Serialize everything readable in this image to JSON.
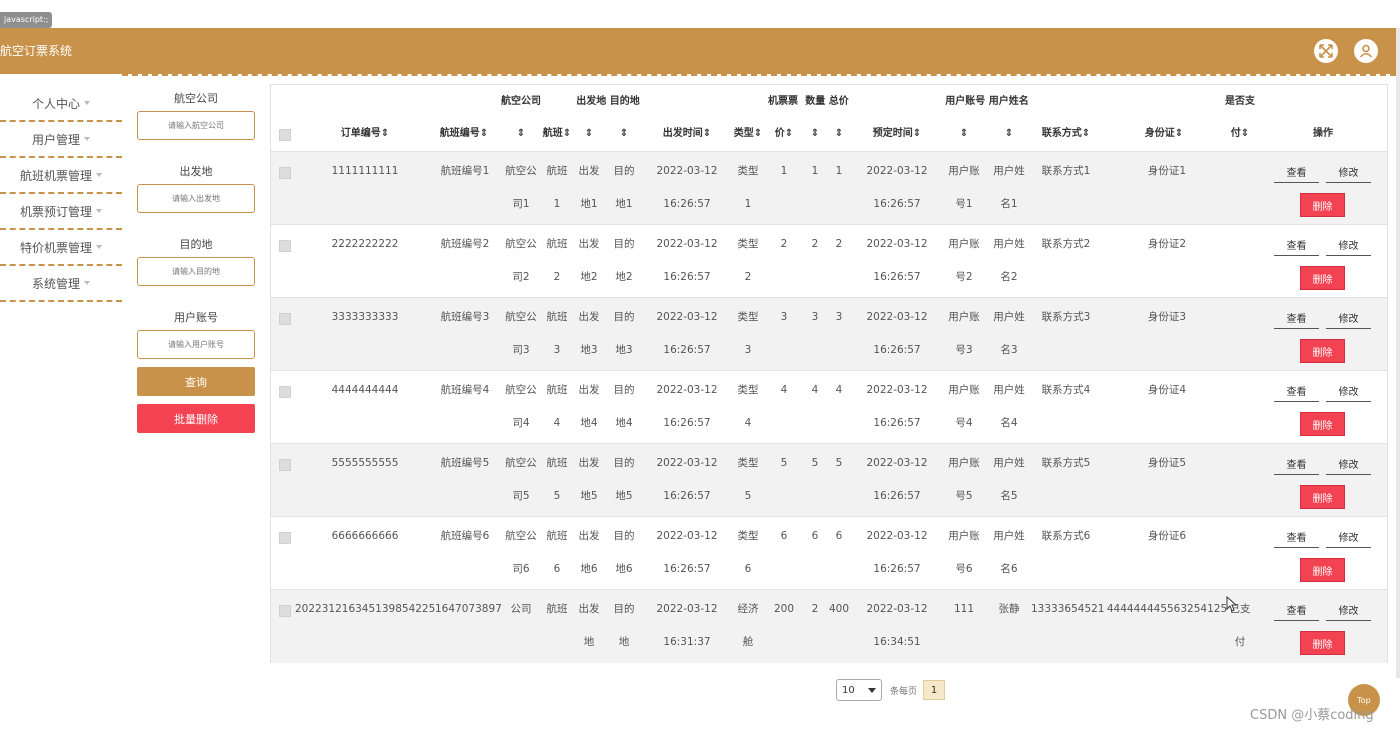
{
  "browser_tab": "javascript:;",
  "header": {
    "title": "航空订票系统",
    "fullscreen_icon": "fullscreen-icon",
    "user_icon": "user-icon"
  },
  "sidebar": {
    "items": [
      {
        "label": "个人中心"
      },
      {
        "label": "用户管理"
      },
      {
        "label": "航班机票管理"
      },
      {
        "label": "机票预订管理"
      },
      {
        "label": "特价机票管理"
      },
      {
        "label": "系统管理"
      }
    ]
  },
  "search": {
    "airline_label": "航空公司",
    "airline_placeholder": "请输入航空公司",
    "depart_label": "出发地",
    "depart_placeholder": "请输入出发地",
    "dest_label": "目的地",
    "dest_placeholder": "请输入目的地",
    "account_label": "用户账号",
    "account_placeholder": "请输入用户账号",
    "query_button": "查询",
    "batch_delete_button": "批量删除"
  },
  "table": {
    "headers_top": {
      "airline": "航空公司",
      "depart_dest": "出发地 目的地",
      "ticket_price": "机票票",
      "qty_total": "数量 总价",
      "account_name": "用户账号 用户姓名",
      "paid": "是否支"
    },
    "headers": {
      "order_no": "订单编号⇕",
      "flight_no": "航班编号⇕",
      "airline": "⇕",
      "flight": "航班⇕",
      "depart": "⇕",
      "dest": "⇕",
      "depart_time": "出发时间⇕",
      "type": "类型⇕",
      "price": "价⇕",
      "qty": "⇕",
      "total": "⇕",
      "book_time": "预定时间⇕",
      "account": "⇕",
      "name": "⇕",
      "contact": "联系方式⇕",
      "id_card": "身份证⇕",
      "paid": "付⇕",
      "ops": "操作"
    },
    "rows": [
      {
        "order_no": "1111111111",
        "flight_no": "航班编号1",
        "airline1": "航空公",
        "airline2": "司1",
        "flight1": "航班",
        "flight2": "1",
        "depart1": "出发",
        "depart2": "地1",
        "dest1": "目的",
        "dest2": "地1",
        "dtime1": "2022-03-12",
        "dtime2": "16:26:57",
        "type1": "类型",
        "type2": "1",
        "price": "1",
        "qty": "1",
        "total": "1",
        "btime1": "2022-03-12",
        "btime2": "16:26:57",
        "acct1": "用户账",
        "acct2": "号1",
        "name1": "用户姓",
        "name2": "名1",
        "contact": "联系方式1",
        "id_card": "身份证1",
        "paid1": "",
        "paid2": ""
      },
      {
        "order_no": "2222222222",
        "flight_no": "航班编号2",
        "airline1": "航空公",
        "airline2": "司2",
        "flight1": "航班",
        "flight2": "2",
        "depart1": "出发",
        "depart2": "地2",
        "dest1": "目的",
        "dest2": "地2",
        "dtime1": "2022-03-12",
        "dtime2": "16:26:57",
        "type1": "类型",
        "type2": "2",
        "price": "2",
        "qty": "2",
        "total": "2",
        "btime1": "2022-03-12",
        "btime2": "16:26:57",
        "acct1": "用户账",
        "acct2": "号2",
        "name1": "用户姓",
        "name2": "名2",
        "contact": "联系方式2",
        "id_card": "身份证2",
        "paid1": "",
        "paid2": ""
      },
      {
        "order_no": "3333333333",
        "flight_no": "航班编号3",
        "airline1": "航空公",
        "airline2": "司3",
        "flight1": "航班",
        "flight2": "3",
        "depart1": "出发",
        "depart2": "地3",
        "dest1": "目的",
        "dest2": "地3",
        "dtime1": "2022-03-12",
        "dtime2": "16:26:57",
        "type1": "类型",
        "type2": "3",
        "price": "3",
        "qty": "3",
        "total": "3",
        "btime1": "2022-03-12",
        "btime2": "16:26:57",
        "acct1": "用户账",
        "acct2": "号3",
        "name1": "用户姓",
        "name2": "名3",
        "contact": "联系方式3",
        "id_card": "身份证3",
        "paid1": "",
        "paid2": ""
      },
      {
        "order_no": "4444444444",
        "flight_no": "航班编号4",
        "airline1": "航空公",
        "airline2": "司4",
        "flight1": "航班",
        "flight2": "4",
        "depart1": "出发",
        "depart2": "地4",
        "dest1": "目的",
        "dest2": "地4",
        "dtime1": "2022-03-12",
        "dtime2": "16:26:57",
        "type1": "类型",
        "type2": "4",
        "price": "4",
        "qty": "4",
        "total": "4",
        "btime1": "2022-03-12",
        "btime2": "16:26:57",
        "acct1": "用户账",
        "acct2": "号4",
        "name1": "用户姓",
        "name2": "名4",
        "contact": "联系方式4",
        "id_card": "身份证4",
        "paid1": "",
        "paid2": ""
      },
      {
        "order_no": "5555555555",
        "flight_no": "航班编号5",
        "airline1": "航空公",
        "airline2": "司5",
        "flight1": "航班",
        "flight2": "5",
        "depart1": "出发",
        "depart2": "地5",
        "dest1": "目的",
        "dest2": "地5",
        "dtime1": "2022-03-12",
        "dtime2": "16:26:57",
        "type1": "类型",
        "type2": "5",
        "price": "5",
        "qty": "5",
        "total": "5",
        "btime1": "2022-03-12",
        "btime2": "16:26:57",
        "acct1": "用户账",
        "acct2": "号5",
        "name1": "用户姓",
        "name2": "名5",
        "contact": "联系方式5",
        "id_card": "身份证5",
        "paid1": "",
        "paid2": ""
      },
      {
        "order_no": "6666666666",
        "flight_no": "航班编号6",
        "airline1": "航空公",
        "airline2": "司6",
        "flight1": "航班",
        "flight2": "6",
        "depart1": "出发",
        "depart2": "地6",
        "dest1": "目的",
        "dest2": "地6",
        "dtime1": "2022-03-12",
        "dtime2": "16:26:57",
        "type1": "类型",
        "type2": "6",
        "price": "6",
        "qty": "6",
        "total": "6",
        "btime1": "2022-03-12",
        "btime2": "16:26:57",
        "acct1": "用户账",
        "acct2": "号6",
        "name1": "用户姓",
        "name2": "名6",
        "contact": "联系方式6",
        "id_card": "身份证6",
        "paid1": "",
        "paid2": ""
      },
      {
        "order_no": "202231216345139854225",
        "flight_no": "1647073897",
        "airline1": "公司",
        "airline2": "",
        "flight1": "航班",
        "flight2": "",
        "depart1": "出发",
        "depart2": "地",
        "dest1": "目的",
        "dest2": "地",
        "dtime1": "2022-03-12",
        "dtime2": "16:31:37",
        "type1": "经济",
        "type2": "舱",
        "price": "200",
        "qty": "2",
        "total": "400",
        "btime1": "2022-03-12",
        "btime2": "16:34:51",
        "acct1": "111",
        "acct2": "",
        "name1": "张静",
        "name2": "",
        "contact": "13333654521",
        "id_card": "444444445563254125",
        "paid1": "已支",
        "paid2": "付"
      }
    ],
    "view_label": "查看",
    "edit_label": "修改",
    "delete_label": "删除"
  },
  "pager": {
    "page_size": "10",
    "per_page_label": "条每页",
    "current_page": "1"
  },
  "top_button": "Top",
  "watermark": "CSDN @小蔡coding"
}
